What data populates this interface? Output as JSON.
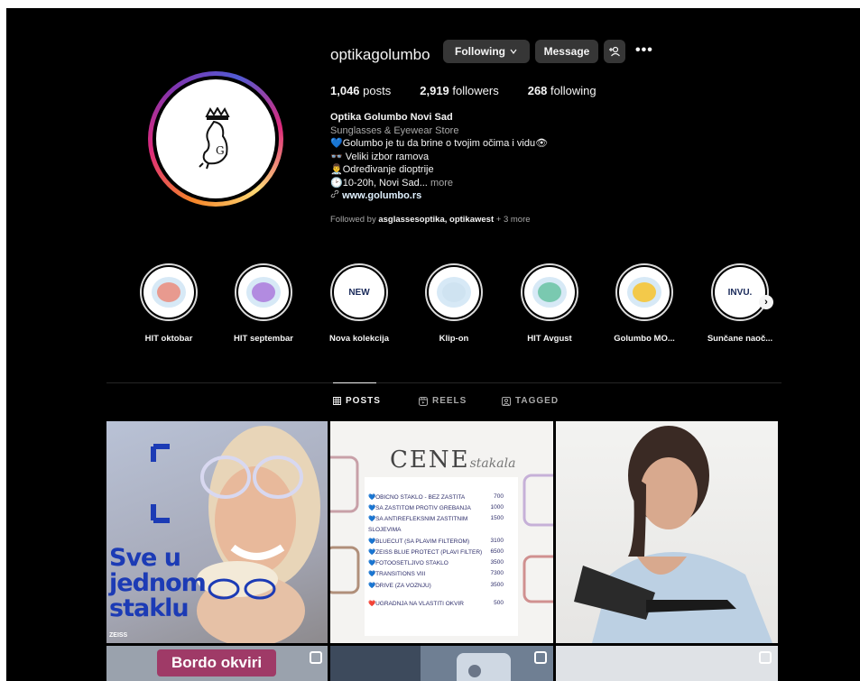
{
  "profile": {
    "username": "optikagolumbo",
    "following_button": "Following",
    "message_button": "Message",
    "posts_count": "1,046",
    "posts_label": "posts",
    "followers_count": "2,919",
    "followers_label": "followers",
    "following_count": "268",
    "following_label": "following",
    "display_name": "Optika Golumbo Novi Sad",
    "category": "Sunglasses & Eyewear Store",
    "bio_lines": [
      "💙Golumbo je tu da brine o tvojim očima i vidu👁",
      "👓 Veliki izbor ramova",
      "👨‍⚕️Određivanje dioptrije",
      "🕑10-20h, Novi Sad..."
    ],
    "more_label": "more",
    "website": "www.golumbo.rs",
    "followed_by_prefix": "Followed by",
    "followed_by_names": "asglassesoptika, optikawest",
    "followed_by_suffix": "+ 3 more",
    "avatar_letter": "G"
  },
  "highlights": [
    {
      "label": "HIT oktobar",
      "color": "#e89a8f"
    },
    {
      "label": "HIT septembar",
      "color": "#b28be0"
    },
    {
      "label": "Nova kolekcija",
      "color": "#e58cc5",
      "text": "NEW"
    },
    {
      "label": "Klip-on",
      "color": "#cfe3f1"
    },
    {
      "label": "HIT Avgust",
      "color": "#7ac9b0"
    },
    {
      "label": "Golumbo MO...",
      "color": "#f3c94a"
    },
    {
      "label": "Sunčane naoč...",
      "color": "#cfe3f1",
      "text": "INVU."
    }
  ],
  "tabs": [
    {
      "label": "POSTS",
      "icon": "grid-icon",
      "active": true
    },
    {
      "label": "REELS",
      "icon": "reels-icon",
      "active": false
    },
    {
      "label": "TAGGED",
      "icon": "tagged-icon",
      "active": false
    }
  ],
  "posts": {
    "post1_text": "Sve u jednom staklu",
    "post1_brand": "ZEISS",
    "post2_title": "CENE",
    "post2_title_script": "stakala",
    "price_list": [
      {
        "item": "💙OBICNO STAKLO - BEZ ZASTITA",
        "price": "700"
      },
      {
        "item": "💙SA ZASTITOM PROTIV GREBANJA",
        "price": "1000"
      },
      {
        "item": "💙SA ANTIREFLEKSNIM ZASTITNIM",
        "price": "1500"
      },
      {
        "item": "SLOJEVIMA",
        "price": ""
      },
      {
        "item": "💙BLUECUT (SA PLAVIM FILTEROM)",
        "price": "3100"
      },
      {
        "item": "💙ZEISS BLUE PROTECT (PLAVI FILTER)",
        "price": "6500"
      },
      {
        "item": "💙FOTOOSETLJIVO STAKLO",
        "price": "3500"
      },
      {
        "item": "💙TRANSITIONS VIII",
        "price": "7300"
      },
      {
        "item": "💙DRIVE (ZA VOZNJU)",
        "price": "3500"
      },
      {
        "item": "❤️UGRADNJA NA VLASTITI OKVIR",
        "price": "500"
      }
    ],
    "post4_text": "Bordo okviri"
  }
}
